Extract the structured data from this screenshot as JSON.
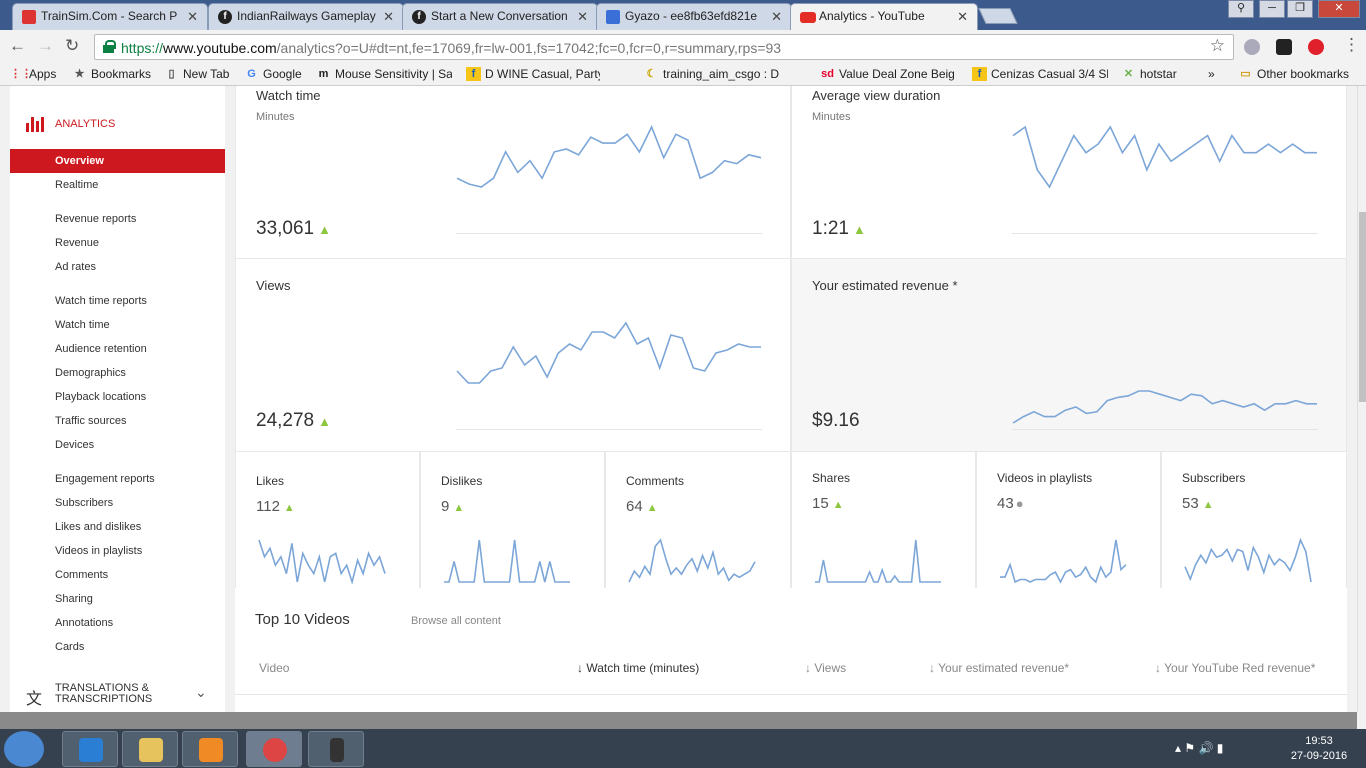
{
  "browser": {
    "tabs": [
      {
        "title": "TrainSim.Com - Search P",
        "icon": "trainsim-favicon"
      },
      {
        "title": "IndianRailways Gameplay",
        "icon": "f-favicon"
      },
      {
        "title": "Start a New Conversation",
        "icon": "f-favicon"
      },
      {
        "title": "Gyazo - ee8fb63efd821e",
        "icon": "gyazo-favicon"
      },
      {
        "title": "Analytics - YouTube",
        "icon": "youtube-favicon"
      }
    ],
    "url": {
      "scheme": "https://",
      "host": "www.youtube.com",
      "path": "/analytics?o=U#dt=nt,fe=17069,fr=lw-001,fs=17042;fc=0,fcr=0,r=summary,rps=93"
    },
    "bookmarks": [
      {
        "label": "Apps",
        "icon": "apps-grid-icon"
      },
      {
        "label": "Bookmarks",
        "icon": "star-icon"
      },
      {
        "label": "New Tab",
        "icon": "page-icon"
      },
      {
        "label": "Google",
        "icon": "google-icon"
      },
      {
        "label": "Mouse Sensitivity | Sa",
        "icon": "m-icon"
      },
      {
        "label": "D WINE Casual, Party",
        "icon": "flipkart-icon"
      },
      {
        "label": "training_aim_csgo : D",
        "icon": "banana-icon"
      },
      {
        "label": "",
        "icon": "feather-icon"
      },
      {
        "label": "Value Deal Zone Beig",
        "icon": "sd-icon"
      },
      {
        "label": "Cenizas Casual 3/4 Sl",
        "icon": "flipkart-icon"
      },
      {
        "label": "hotstar",
        "icon": "hotstar-icon"
      },
      {
        "label": "»",
        "icon": ""
      },
      {
        "label": "Other bookmarks",
        "icon": "folder-icon"
      }
    ]
  },
  "sidebar": {
    "header": "ANALYTICS",
    "items": [
      {
        "label": "Overview",
        "active": true
      },
      {
        "label": "Realtime"
      },
      {
        "label": "Revenue reports"
      },
      {
        "label": "Revenue"
      },
      {
        "label": "Ad rates"
      },
      {
        "label": "Watch time reports"
      },
      {
        "label": "Watch time"
      },
      {
        "label": "Audience retention"
      },
      {
        "label": "Demographics"
      },
      {
        "label": "Playback locations"
      },
      {
        "label": "Traffic sources"
      },
      {
        "label": "Devices"
      },
      {
        "label": "Engagement reports"
      },
      {
        "label": "Subscribers"
      },
      {
        "label": "Likes and dislikes"
      },
      {
        "label": "Videos in playlists"
      },
      {
        "label": "Comments"
      },
      {
        "label": "Sharing"
      },
      {
        "label": "Annotations"
      },
      {
        "label": "Cards"
      }
    ],
    "translations": "TRANSLATIONS & TRANSCRIPTIONS"
  },
  "metrics": {
    "watch_time": {
      "title": "Watch time",
      "unit": "Minutes",
      "value": "33,061"
    },
    "avg_view_duration": {
      "title": "Average view duration",
      "unit": "Minutes",
      "value": "1:21"
    },
    "views": {
      "title": "Views",
      "value": "24,278"
    },
    "revenue": {
      "title": "Your estimated revenue *",
      "value": "$9.16"
    }
  },
  "engagement": [
    {
      "title": "Likes",
      "value": "112",
      "trend": "up"
    },
    {
      "title": "Dislikes",
      "value": "9",
      "trend": "up"
    },
    {
      "title": "Comments",
      "value": "64",
      "trend": "up"
    },
    {
      "title": "Shares",
      "value": "15",
      "trend": "up"
    },
    {
      "title": "Videos in playlists",
      "value": "43",
      "trend": "flat"
    },
    {
      "title": "Subscribers",
      "value": "53",
      "trend": "up"
    }
  ],
  "top10": {
    "title": "Top 10 Videos",
    "browse": "Browse all content",
    "columns": [
      "Video",
      "Watch time (minutes)",
      "Views",
      "Your estimated revenue*",
      "Your YouTube Red revenue*"
    ]
  },
  "taskbar": {
    "time": "19:53",
    "date": "27-09-2016"
  },
  "colors": {
    "accent": "#cc181e",
    "trend_up": "#8dc63f",
    "spark_line": "#7ca6d8"
  },
  "chart_data": [
    {
      "type": "line",
      "name": "watch-time-sparkline",
      "values": [
        22,
        18,
        16,
        22,
        40,
        26,
        34,
        22,
        40,
        42,
        38,
        50,
        46,
        46,
        52,
        40,
        57,
        36,
        52,
        48,
        22,
        26,
        34,
        32,
        38,
        36
      ]
    },
    {
      "type": "line",
      "name": "avg-duration-sparkline",
      "values": [
        48,
        49,
        44,
        42,
        45,
        48,
        46,
        47,
        49,
        46,
        48,
        44,
        47,
        45,
        46,
        47,
        48,
        45,
        48,
        46,
        46,
        47,
        46,
        47,
        46,
        46
      ]
    },
    {
      "type": "line",
      "name": "views-sparkline",
      "values": [
        28,
        20,
        20,
        28,
        30,
        44,
        32,
        38,
        24,
        40,
        46,
        42,
        54,
        54,
        50,
        60,
        46,
        50,
        30,
        52,
        50,
        30,
        28,
        40,
        42,
        46,
        44,
        44
      ]
    },
    {
      "type": "line",
      "name": "revenue-sparkline",
      "values": [
        8,
        12,
        15,
        12,
        12,
        16,
        18,
        14,
        15,
        22,
        24,
        25,
        28,
        28,
        26,
        24,
        22,
        26,
        25,
        20,
        22,
        20,
        18,
        20,
        16,
        20,
        20,
        22,
        20,
        20
      ]
    },
    {
      "type": "line",
      "name": "likes-sparkline",
      "values": [
        30,
        20,
        25,
        15,
        20,
        10,
        28,
        5,
        22,
        15,
        10,
        20,
        5,
        20,
        22,
        10,
        15,
        5,
        18,
        10,
        22,
        15,
        20,
        10
      ]
    },
    {
      "type": "line",
      "name": "dislikes-sparkline",
      "values": [
        0,
        0,
        22,
        0,
        0,
        0,
        0,
        45,
        0,
        0,
        0,
        0,
        0,
        0,
        45,
        0,
        0,
        0,
        0,
        22,
        0,
        22,
        0,
        0,
        0,
        0
      ]
    },
    {
      "type": "line",
      "name": "comments-sparkline",
      "values": [
        5,
        12,
        8,
        15,
        10,
        28,
        32,
        20,
        10,
        14,
        10,
        16,
        20,
        12,
        22,
        14,
        24,
        10,
        14,
        6,
        10,
        8,
        10,
        12,
        18
      ]
    },
    {
      "type": "line",
      "name": "shares-sparkline",
      "values": [
        0,
        0,
        22,
        0,
        0,
        0,
        0,
        0,
        0,
        0,
        0,
        0,
        0,
        10,
        0,
        0,
        12,
        0,
        0,
        6,
        0,
        0,
        0,
        0,
        42,
        0,
        0,
        0,
        0,
        0,
        0
      ]
    },
    {
      "type": "line",
      "name": "playlists-sparkline",
      "values": [
        8,
        8,
        18,
        4,
        6,
        6,
        4,
        6,
        6,
        6,
        10,
        12,
        4,
        12,
        14,
        8,
        10,
        16,
        8,
        4,
        16,
        8,
        12,
        38,
        14,
        18
      ]
    },
    {
      "type": "line",
      "name": "subscribers-sparkline",
      "values": [
        18,
        5,
        20,
        30,
        22,
        36,
        28,
        30,
        36,
        24,
        36,
        34,
        14,
        38,
        28,
        12,
        30,
        20,
        26,
        22,
        14,
        28,
        46,
        34,
        2
      ]
    }
  ]
}
